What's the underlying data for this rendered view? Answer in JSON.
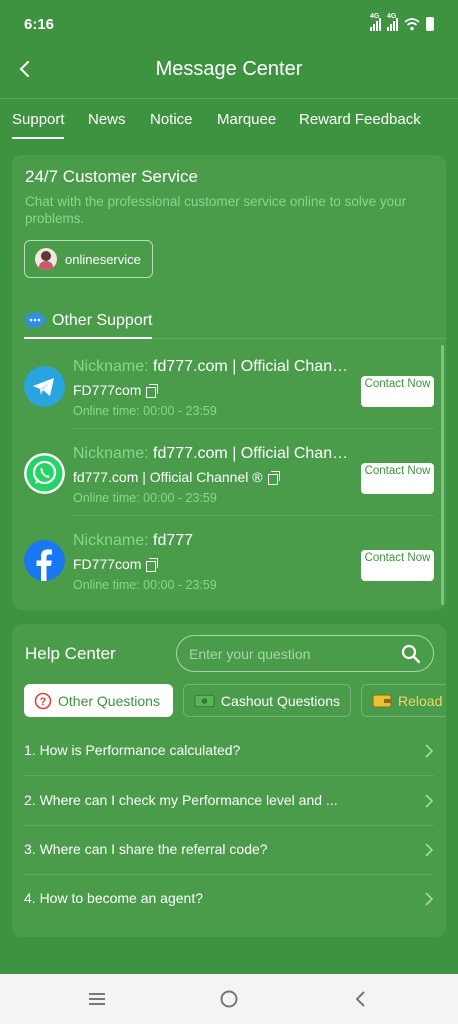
{
  "status": {
    "time": "6:16",
    "net1": "4G",
    "net2": "4G"
  },
  "header": {
    "title": "Message Center"
  },
  "tabs": [
    "Support",
    "News",
    "Notice",
    "Marquee",
    "Reward Feedback"
  ],
  "customer_service": {
    "title": "24/7 Customer Service",
    "subtitle": "Chat with the professional customer service online to solve your problems.",
    "online_label": "onlineservice"
  },
  "other_support": {
    "title": "Other Support",
    "nickname_label": "Nickname:",
    "contact_label": "Contact Now",
    "items": [
      {
        "platform": "telegram",
        "nickname": "fd777.com | Official Channel",
        "account": "FD777com",
        "online_time": "Online time: 00:00 - 23:59"
      },
      {
        "platform": "whatsapp",
        "nickname": "fd777.com | Official Channel",
        "account": "fd777.com | Official Channel ®",
        "online_time": "Online time: 00:00 - 23:59"
      },
      {
        "platform": "facebook",
        "nickname": "fd777",
        "account": "FD777com",
        "online_time": "Online time: 00:00 - 23:59"
      }
    ]
  },
  "help_center": {
    "title": "Help Center",
    "search_placeholder": "Enter your question",
    "chips": [
      "Other Questions",
      "Cashout Questions",
      "Reload"
    ],
    "questions": [
      "1. How is Performance calculated?",
      "2. Where can I check my Performance level and ...",
      "3. Where can I share the referral code?",
      "4. How to become an agent?"
    ]
  },
  "colors": {
    "background": "#3e9340",
    "card": "#4a9c4b",
    "muted_text": "#8ed28f",
    "telegram": "#2aa4df",
    "whatsapp": "#25d366",
    "facebook": "#1877f2"
  }
}
